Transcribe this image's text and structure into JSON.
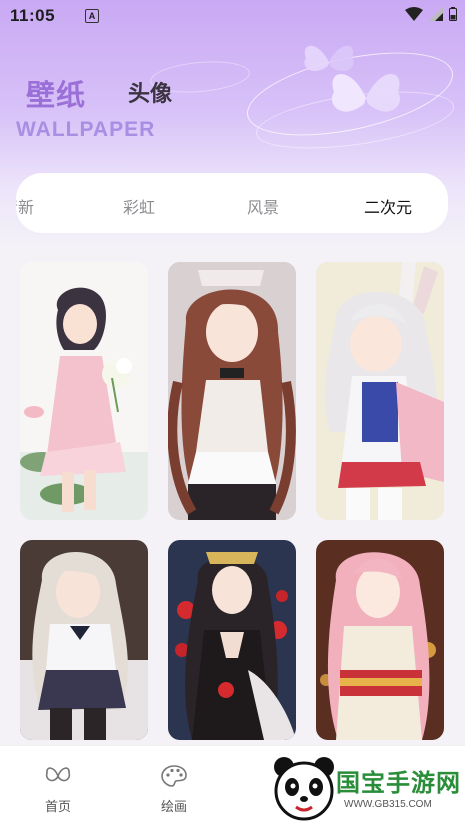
{
  "status_bar": {
    "time": "11:05",
    "notification_icon": "a-letter-icon",
    "icons": [
      "wifi-icon",
      "signal-icon",
      "battery-icon"
    ]
  },
  "header": {
    "title": "壁纸",
    "secondary_title": "头像",
    "subtitle_en": "WALLPAPER",
    "decoration": "butterfly-icon"
  },
  "category_tabs": [
    {
      "label": "清新",
      "active": false
    },
    {
      "label": "彩虹",
      "active": false
    },
    {
      "label": "风景",
      "active": false
    },
    {
      "label": "二次元",
      "active": true
    }
  ],
  "wallpapers": [
    {
      "subject": "girl with flowers in pink dress"
    },
    {
      "subject": "maid girl with brown hair"
    },
    {
      "subject": "white-haired bunny girl"
    },
    {
      "subject": "girl in sailor uniform"
    },
    {
      "subject": "girl with red roses"
    },
    {
      "subject": "girl in kimono"
    }
  ],
  "bottom_nav": [
    {
      "label": "首页",
      "icon": "butterfly-icon"
    },
    {
      "label": "绘画",
      "icon": "palette-icon"
    }
  ],
  "watermark": {
    "text": "国宝手游网",
    "url": "WWW.GB315.COM"
  },
  "colors": {
    "accent": "#9a6fd8",
    "header_gradient_top": "#c9a9f4",
    "background": "#f4f2f7",
    "tab_active": "#111111",
    "tab_inactive": "#8d8d91"
  }
}
